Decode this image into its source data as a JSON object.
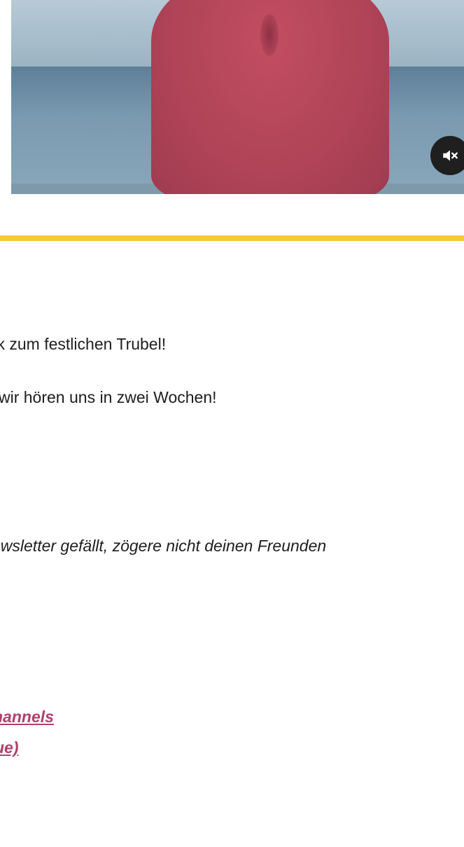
{
  "video": {
    "mute_icon": "volume-muted-icon"
  },
  "content": {
    "line1": "ck zum festlichen Trubel!",
    "line2": "wir hören uns in zwei Wochen!",
    "italic_line": "ewsletter gefällt, zögere nicht deinen Freunden"
  },
  "links": {
    "link1": "hannels",
    "link2": "ue)"
  },
  "colors": {
    "divider": "#f5c935",
    "link": "#b0416a",
    "mute_button": "#1f1f1f"
  }
}
